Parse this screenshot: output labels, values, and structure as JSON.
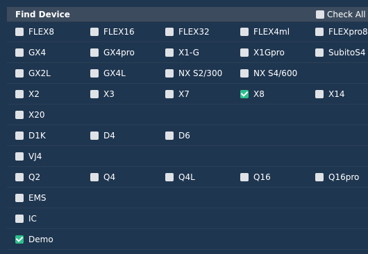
{
  "header": {
    "title": "Find Device",
    "check_all_label": "Check All",
    "check_all_checked": false
  },
  "rows": [
    [
      {
        "label": "FLEX8",
        "checked": false
      },
      {
        "label": "FLEX16",
        "checked": false
      },
      {
        "label": "FLEX32",
        "checked": false
      },
      {
        "label": "FLEX4ml",
        "checked": false
      },
      {
        "label": "FLEXpro8",
        "checked": false
      }
    ],
    [
      {
        "label": "GX4",
        "checked": false
      },
      {
        "label": "GX4pro",
        "checked": false
      },
      {
        "label": "X1-G",
        "checked": false
      },
      {
        "label": "X1Gpro",
        "checked": false
      },
      {
        "label": "SubitoS4",
        "checked": false
      }
    ],
    [
      {
        "label": "GX2L",
        "checked": false
      },
      {
        "label": "GX4L",
        "checked": false
      },
      {
        "label": "NX S2/300",
        "checked": false
      },
      {
        "label": "NX S4/600",
        "checked": false
      }
    ],
    [
      {
        "label": "X2",
        "checked": false
      },
      {
        "label": "X3",
        "checked": false
      },
      {
        "label": "X7",
        "checked": false
      },
      {
        "label": "X8",
        "checked": true
      },
      {
        "label": "X14",
        "checked": false
      }
    ],
    [
      {
        "label": "X20",
        "checked": false
      }
    ],
    [
      {
        "label": "D1K",
        "checked": false
      },
      {
        "label": "D4",
        "checked": false
      },
      {
        "label": "D6",
        "checked": false
      }
    ],
    [
      {
        "label": "VJ4",
        "checked": false
      }
    ],
    [
      {
        "label": "Q2",
        "checked": false
      },
      {
        "label": "Q4",
        "checked": false
      },
      {
        "label": "Q4L",
        "checked": false
      },
      {
        "label": "Q16",
        "checked": false
      },
      {
        "label": "Q16pro",
        "checked": false
      }
    ],
    [
      {
        "label": "EMS",
        "checked": false
      }
    ],
    [
      {
        "label": "IC",
        "checked": false
      }
    ],
    [
      {
        "label": "Demo",
        "checked": true
      }
    ]
  ],
  "colors": {
    "background": "#1f3650",
    "header": "#3c4c5e",
    "checkbox": "#dfe2e6",
    "checked": "#2ebf8c"
  }
}
